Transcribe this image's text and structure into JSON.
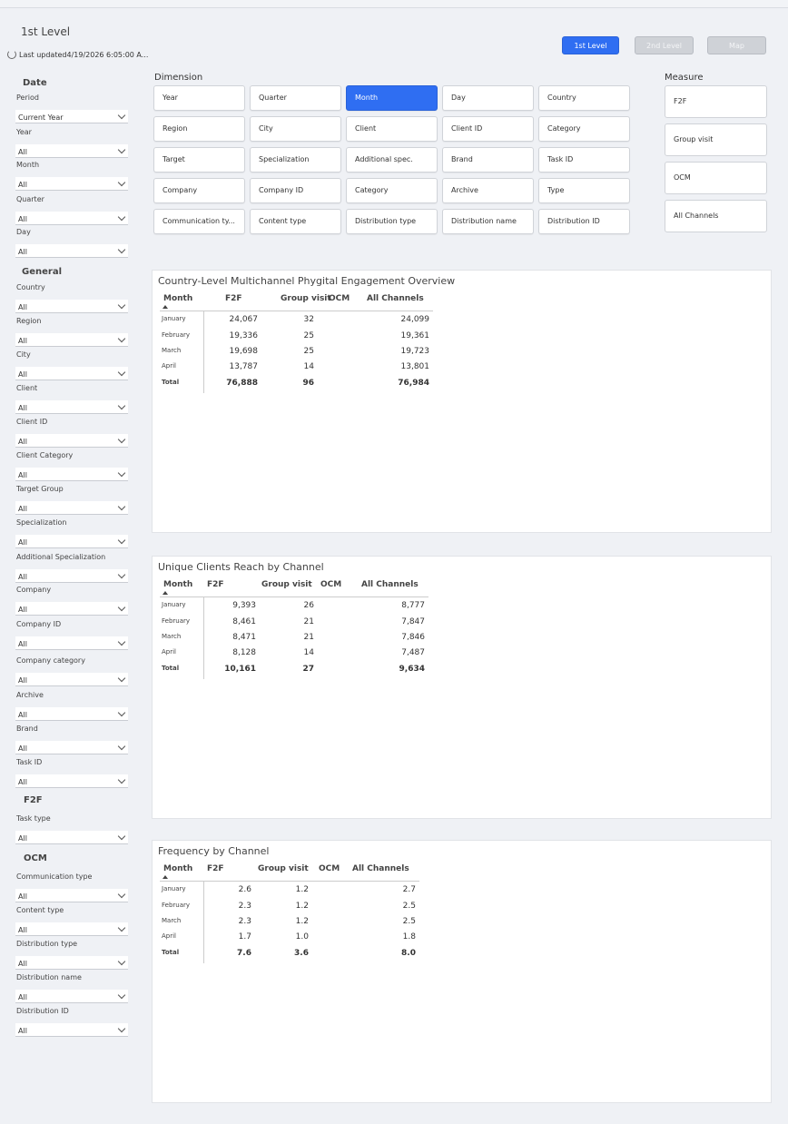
{
  "header": {
    "title": "1st Level",
    "last_updated": "Last updated4/19/2026 6:05:00 A...",
    "nav": [
      "1st Level",
      "2nd Level",
      "Map"
    ]
  },
  "filters": {
    "date_heading": "Date",
    "general_heading": "General",
    "f2f_heading": "F2F",
    "ocm_heading": "OCM",
    "items": [
      {
        "label": "Period",
        "value": "Current Year"
      },
      {
        "label": "Year",
        "value": "All"
      },
      {
        "label": "Month",
        "value": "All"
      },
      {
        "label": "Quarter",
        "value": "All"
      },
      {
        "label": "Day",
        "value": "All"
      },
      {
        "label": "Country",
        "value": "All"
      },
      {
        "label": "Region",
        "value": "All"
      },
      {
        "label": "City",
        "value": "All"
      },
      {
        "label": "Client",
        "value": "All"
      },
      {
        "label": "Client ID",
        "value": "All"
      },
      {
        "label": "Client Category",
        "value": "All"
      },
      {
        "label": "Target Group",
        "value": "All"
      },
      {
        "label": "Specialization",
        "value": "All"
      },
      {
        "label": "Additional Specialization",
        "value": "All"
      },
      {
        "label": "Company",
        "value": "All"
      },
      {
        "label": "Company ID",
        "value": "All"
      },
      {
        "label": "Company category",
        "value": "All"
      },
      {
        "label": "Archive",
        "value": "All"
      },
      {
        "label": "Brand",
        "value": "All"
      },
      {
        "label": "Task ID",
        "value": "All"
      },
      {
        "label": "Task type",
        "value": "All"
      },
      {
        "label": "Communication type",
        "value": "All"
      },
      {
        "label": "Content type",
        "value": "All"
      },
      {
        "label": "Distribution type",
        "value": "All"
      },
      {
        "label": "Distribution name",
        "value": "All"
      },
      {
        "label": "Distribution ID",
        "value": "All"
      }
    ]
  },
  "dimension": {
    "title": "Dimension",
    "selected": "Month",
    "buttons": [
      "Year",
      "Quarter",
      "Month",
      "Day",
      "Country",
      "Region",
      "City",
      "Client",
      "Client ID",
      "Category",
      "Target",
      "Specialization",
      "Additional spec.",
      "Brand",
      "Task ID",
      "Company",
      "Company ID",
      "Category",
      "Archive",
      "Type",
      "Communication ty...",
      "Content type",
      "Distribution type",
      "Distribution name",
      "Distribution ID"
    ]
  },
  "measure": {
    "title": "Measure",
    "buttons": [
      "F2F",
      "Group visit",
      "OCM",
      "All Channels"
    ]
  },
  "tables": [
    {
      "title": "Country-Level Multichannel Phygital Engagement Overview",
      "headers": [
        "Month",
        "F2F",
        "Group visit",
        "OCM",
        "All Channels"
      ],
      "rows": [
        {
          "label": "January",
          "f2f": "24,067",
          "group": "32",
          "ocm": "",
          "all": "24,099"
        },
        {
          "label": "February",
          "f2f": "19,336",
          "group": "25",
          "ocm": "",
          "all": "19,361"
        },
        {
          "label": "March",
          "f2f": "19,698",
          "group": "25",
          "ocm": "",
          "all": "19,723"
        },
        {
          "label": "April",
          "f2f": "13,787",
          "group": "14",
          "ocm": "",
          "all": "13,801"
        }
      ],
      "total": {
        "label": "Total",
        "f2f": "76,888",
        "group": "96",
        "ocm": "",
        "all": "76,984"
      }
    },
    {
      "title": "Unique Clients Reach by Channel",
      "headers": [
        "Month",
        "F2F",
        "Group visit",
        "OCM",
        "All Channels"
      ],
      "rows": [
        {
          "label": "January",
          "f2f": "9,393",
          "group": "26",
          "ocm": "",
          "all": "8,777"
        },
        {
          "label": "February",
          "f2f": "8,461",
          "group": "21",
          "ocm": "",
          "all": "7,847"
        },
        {
          "label": "March",
          "f2f": "8,471",
          "group": "21",
          "ocm": "",
          "all": "7,846"
        },
        {
          "label": "April",
          "f2f": "8,128",
          "group": "14",
          "ocm": "",
          "all": "7,487"
        }
      ],
      "total": {
        "label": "Total",
        "f2f": "10,161",
        "group": "27",
        "ocm": "",
        "all": "9,634"
      }
    },
    {
      "title": "Frequency by Channel",
      "headers": [
        "Month",
        "F2F",
        "Group visit",
        "OCM",
        "All Channels"
      ],
      "rows": [
        {
          "label": "January",
          "f2f": "2.6",
          "group": "1.2",
          "ocm": "",
          "all": "2.7"
        },
        {
          "label": "February",
          "f2f": "2.3",
          "group": "1.2",
          "ocm": "",
          "all": "2.5"
        },
        {
          "label": "March",
          "f2f": "2.3",
          "group": "1.2",
          "ocm": "",
          "all": "2.5"
        },
        {
          "label": "April",
          "f2f": "1.7",
          "group": "1.0",
          "ocm": "",
          "all": "1.8"
        }
      ],
      "total": {
        "label": "Total",
        "f2f": "7.6",
        "group": "3.6",
        "ocm": "",
        "all": "8.0"
      }
    }
  ]
}
